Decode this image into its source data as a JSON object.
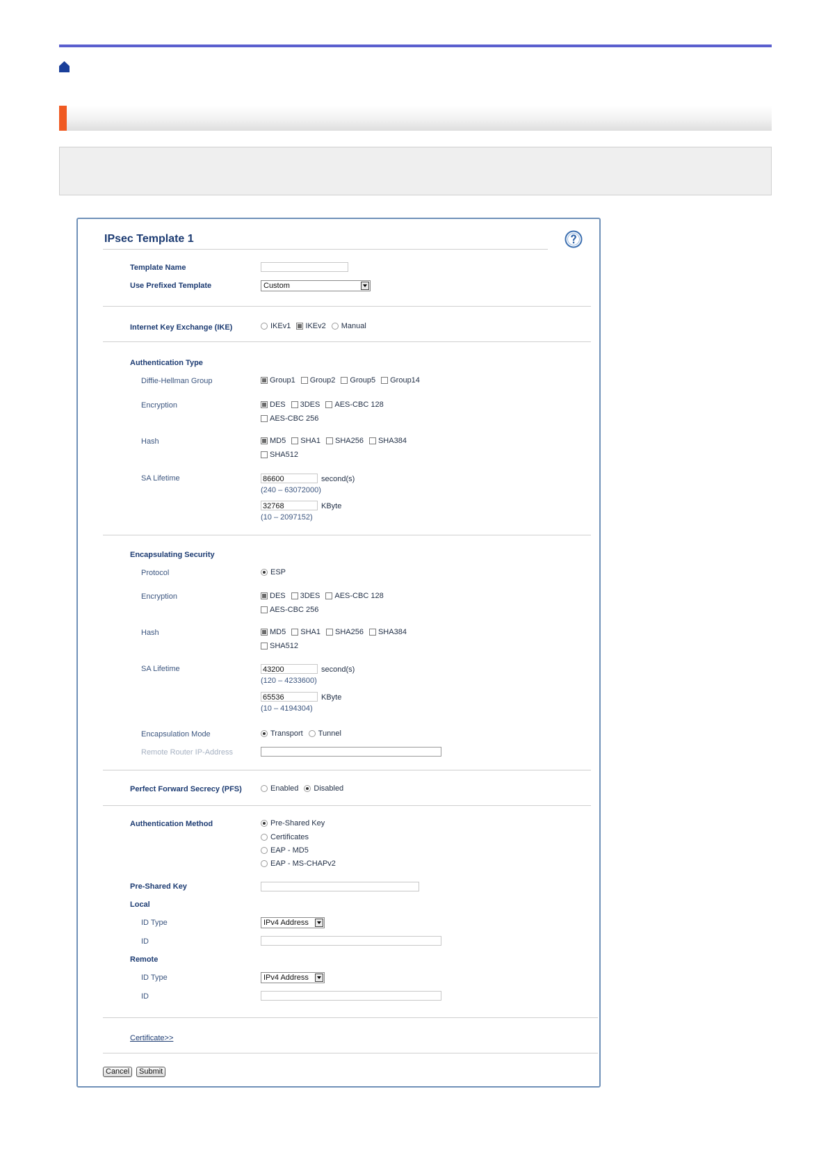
{
  "page": {
    "accent": "#f05a22",
    "topbar_color": "#5a5fce"
  },
  "panel": {
    "title": "IPsec Template 1",
    "help_icon": "help-icon",
    "template_name": {
      "label": "Template Name",
      "value": ""
    },
    "prefixed_template": {
      "label": "Use Prefixed Template",
      "value": "Custom"
    },
    "ike": {
      "label": "Internet Key Exchange (IKE)",
      "options": [
        {
          "label": "IKEv1",
          "selected": false
        },
        {
          "label": "IKEv2",
          "selected": true
        },
        {
          "label": "Manual",
          "selected": false
        }
      ]
    },
    "auth_type": {
      "label": "Authentication Type",
      "dh_label": "Diffie-Hellman Group",
      "dh_options": [
        {
          "label": "Group1",
          "checked": true
        },
        {
          "label": "Group2",
          "checked": false
        },
        {
          "label": "Group5",
          "checked": false
        },
        {
          "label": "Group14",
          "checked": false
        }
      ],
      "enc_label": "Encryption",
      "enc_options": [
        {
          "label": "DES",
          "checked": true
        },
        {
          "label": "3DES",
          "checked": false
        },
        {
          "label": "AES-CBC 128",
          "checked": false
        },
        {
          "label": "AES-CBC 256",
          "checked": false
        }
      ],
      "hash_label": "Hash",
      "hash_options": [
        {
          "label": "MD5",
          "checked": true
        },
        {
          "label": "SHA1",
          "checked": false
        },
        {
          "label": "SHA256",
          "checked": false
        },
        {
          "label": "SHA384",
          "checked": false
        },
        {
          "label": "SHA512",
          "checked": false
        }
      ],
      "sa_label": "SA Lifetime",
      "sa_seconds": "86600",
      "sa_seconds_unit": "second(s)",
      "sa_seconds_range": "(240 – 63072000)",
      "sa_kbyte": "32768",
      "sa_kbyte_unit": "KByte",
      "sa_kbyte_range": "(10 – 2097152)"
    },
    "esp": {
      "label": "Encapsulating Security",
      "protocol_label": "Protocol",
      "protocol_value": "ESP",
      "enc_label": "Encryption",
      "enc_options": [
        {
          "label": "DES",
          "checked": true
        },
        {
          "label": "3DES",
          "checked": false
        },
        {
          "label": "AES-CBC 128",
          "checked": false
        },
        {
          "label": "AES-CBC 256",
          "checked": false
        }
      ],
      "hash_label": "Hash",
      "hash_options": [
        {
          "label": "MD5",
          "checked": true
        },
        {
          "label": "SHA1",
          "checked": false
        },
        {
          "label": "SHA256",
          "checked": false
        },
        {
          "label": "SHA384",
          "checked": false
        },
        {
          "label": "SHA512",
          "checked": false
        }
      ],
      "sa_label": "SA Lifetime",
      "sa_seconds": "43200",
      "sa_seconds_unit": "second(s)",
      "sa_seconds_range": "(120 – 4233600)",
      "sa_kbyte": "65536",
      "sa_kbyte_unit": "KByte",
      "sa_kbyte_range": "(10 – 4194304)",
      "mode_label": "Encapsulation Mode",
      "mode_options": [
        {
          "label": "Transport",
          "selected": true
        },
        {
          "label": "Tunnel",
          "selected": false
        }
      ],
      "remote_router_label": "Remote Router IP-Address",
      "remote_router_value": ""
    },
    "pfs": {
      "label": "Perfect Forward Secrecy (PFS)",
      "options": [
        {
          "label": "Enabled",
          "selected": false
        },
        {
          "label": "Disabled",
          "selected": true
        }
      ]
    },
    "auth_method": {
      "label": "Authentication Method",
      "options": [
        {
          "label": "Pre-Shared Key",
          "selected": true
        },
        {
          "label": "Certificates",
          "selected": false
        },
        {
          "label": "EAP - MD5",
          "selected": false
        },
        {
          "label": "EAP - MS-CHAPv2",
          "selected": false
        }
      ]
    },
    "psk": {
      "label": "Pre-Shared Key",
      "value": ""
    },
    "local": {
      "label": "Local",
      "id_type_label": "ID Type",
      "id_type_value": "IPv4 Address",
      "id_label": "ID",
      "id_value": ""
    },
    "remote": {
      "label": "Remote",
      "id_type_label": "ID Type",
      "id_type_value": "IPv4 Address",
      "id_label": "ID",
      "id_value": ""
    },
    "certificate_link": "Certificate>>",
    "cancel_label": "Cancel",
    "submit_label": "Submit"
  }
}
